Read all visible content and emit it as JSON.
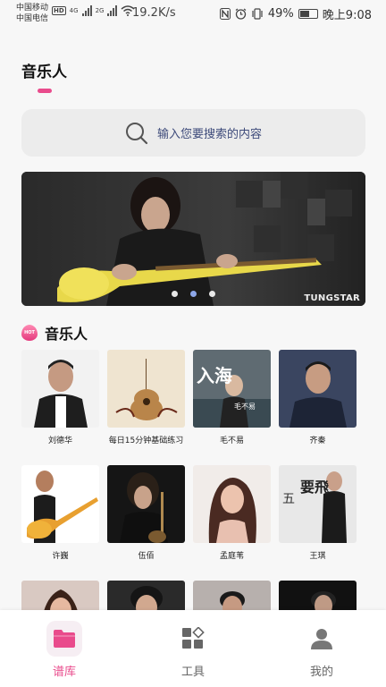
{
  "status_bar": {
    "carrier_1": "中国移动",
    "carrier_2": "中国电信",
    "hd": "HD",
    "net_4g": "4G",
    "net_2g": "2G",
    "net_speed": "19.2K/s",
    "battery_pct": "49%",
    "time": "晚上9:08"
  },
  "header": {
    "title": "音乐人"
  },
  "search": {
    "placeholder": "输入您要搜索的内容"
  },
  "banner": {
    "brand": "TUNGSTAR",
    "dot_count": 3,
    "active_dot": 1
  },
  "section": {
    "badge": "HOT",
    "title": "音乐人"
  },
  "artists": [
    {
      "name": "刘德华"
    },
    {
      "name": "每日15分钟基础练习"
    },
    {
      "name": "毛不易"
    },
    {
      "name": "齐秦"
    },
    {
      "name": "许巍"
    },
    {
      "name": "伍佰"
    },
    {
      "name": "孟庭苇"
    },
    {
      "name": "王琪"
    }
  ],
  "artist_thumb_text": {
    "maobuyi_title": "入海",
    "maobuyi_sub": "毛不易",
    "wangqi_title": "要飛",
    "wangqi_side": "五"
  },
  "tabs": [
    {
      "label": "谱库",
      "icon": "folder-icon",
      "active": true
    },
    {
      "label": "工具",
      "icon": "tools-grid-icon",
      "active": false
    },
    {
      "label": "我的",
      "icon": "person-icon",
      "active": false
    }
  ],
  "colors": {
    "accent": "#e94b8c",
    "search_bg": "#ececec",
    "page_bg": "#f7f7f7"
  }
}
